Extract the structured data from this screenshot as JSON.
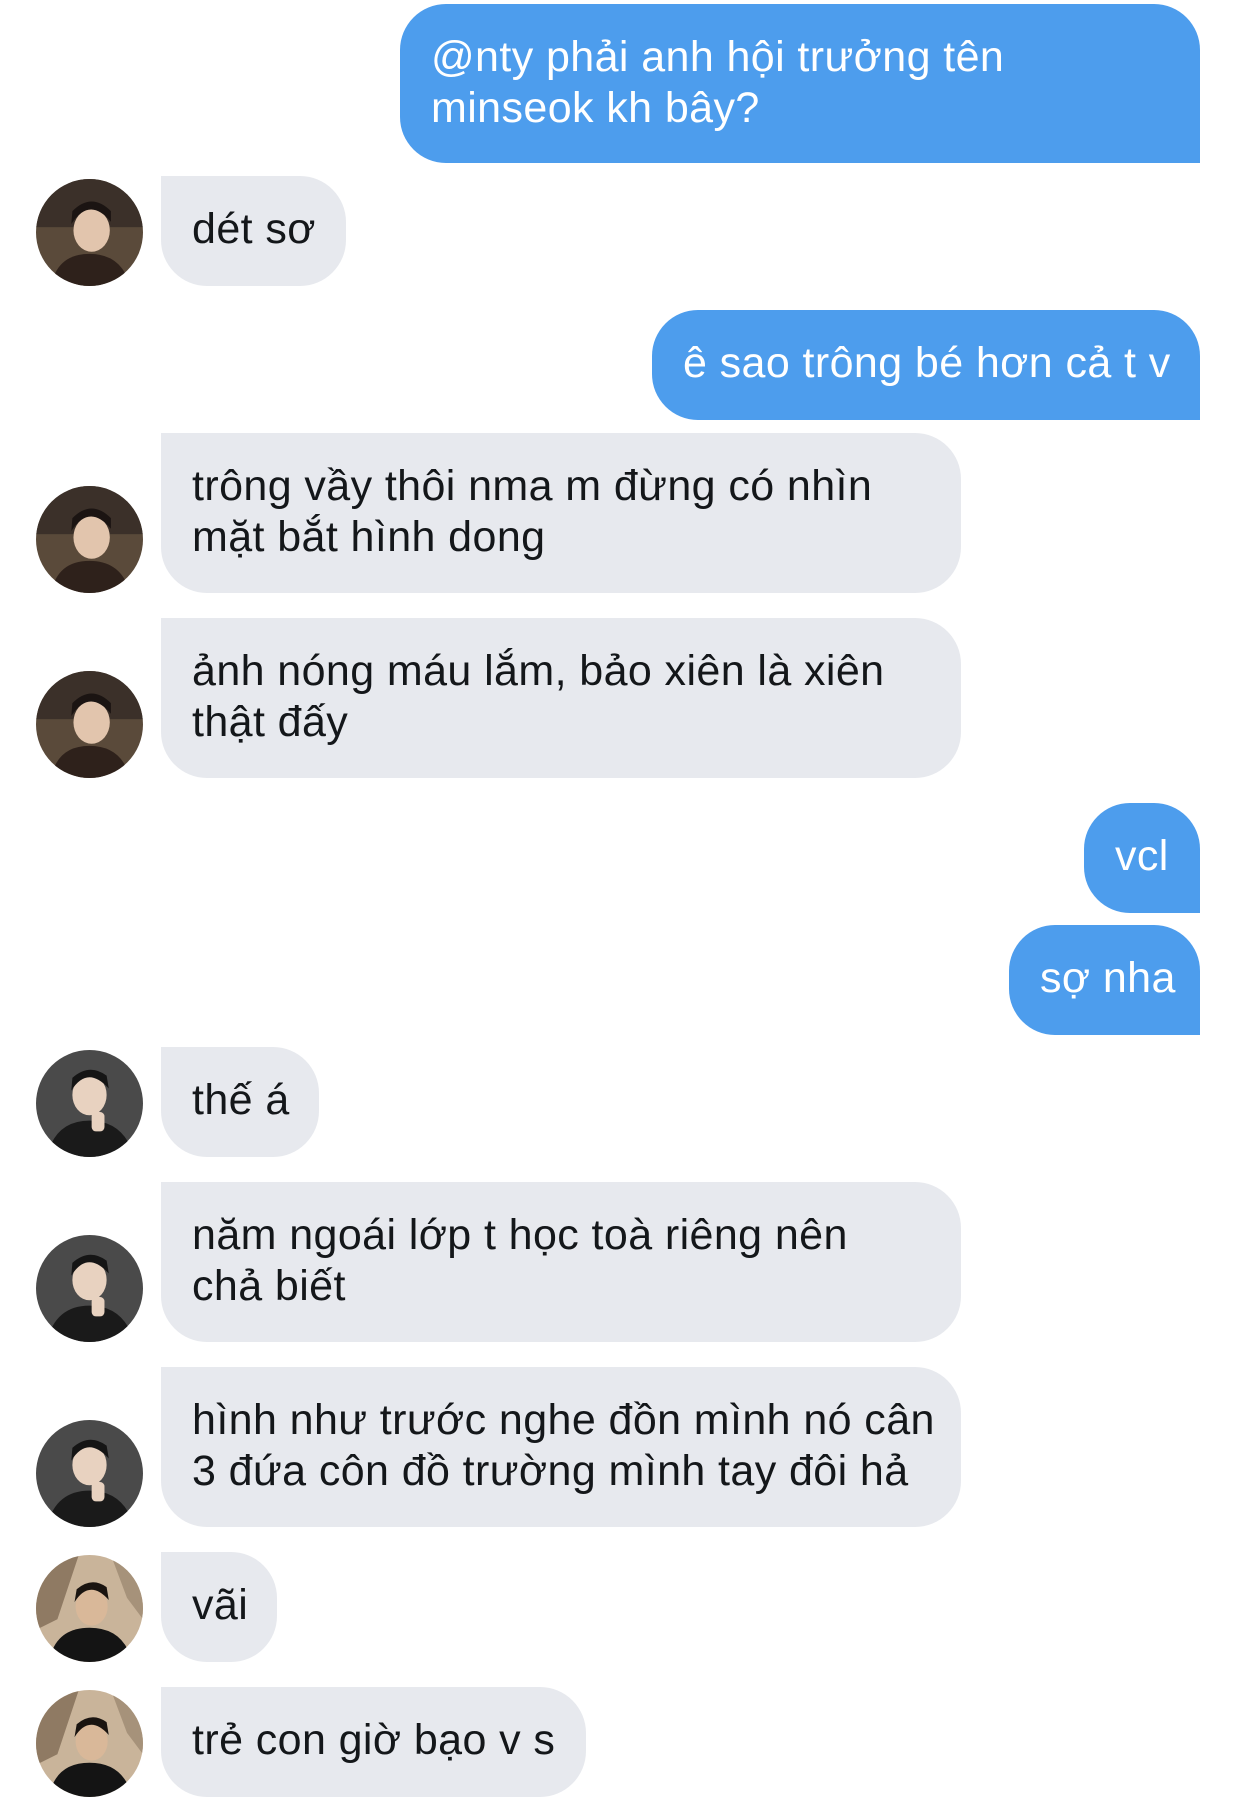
{
  "messages": [
    {
      "direction": "sent",
      "lines": [
        "@nty phải anh hội trưởng tên",
        "minseok kh bây?"
      ]
    },
    {
      "direction": "received",
      "sender": "A",
      "lines": [
        "dét sơ"
      ]
    },
    {
      "direction": "sent",
      "lines": [
        "ê sao trông bé hơn cả t v"
      ]
    },
    {
      "direction": "received",
      "sender": "A",
      "lines": [
        "trông vầy thôi nma m đừng có nhìn",
        "mặt bắt hình dong"
      ]
    },
    {
      "direction": "received",
      "sender": "A",
      "lines": [
        "ảnh nóng máu lắm, bảo xiên là xiên",
        "thật đấy"
      ]
    },
    {
      "direction": "sent",
      "lines": [
        "vcl"
      ]
    },
    {
      "direction": "sent",
      "lines": [
        "sợ nha"
      ]
    },
    {
      "direction": "received",
      "sender": "B",
      "lines": [
        "thế á"
      ]
    },
    {
      "direction": "received",
      "sender": "B",
      "lines": [
        "năm ngoái lớp t học toà riêng nên",
        "chả biết"
      ]
    },
    {
      "direction": "received",
      "sender": "B",
      "lines": [
        "hình như trước nghe đồn mình nó cân",
        "3 đứa côn đồ trường mình tay đôi hả"
      ]
    },
    {
      "direction": "received",
      "sender": "C",
      "lines": [
        "vãi"
      ]
    },
    {
      "direction": "received",
      "sender": "C",
      "lines": [
        "trẻ con giờ bạo v s"
      ]
    }
  ],
  "colors": {
    "sent_bubble": "#4d9ded",
    "received_bubble": "#e7e9ee",
    "sent_text": "#ffffff",
    "received_text": "#14171a"
  },
  "icons": {
    "avatar_a": "avatar-icon",
    "avatar_b": "avatar-icon",
    "avatar_c": "avatar-icon"
  }
}
